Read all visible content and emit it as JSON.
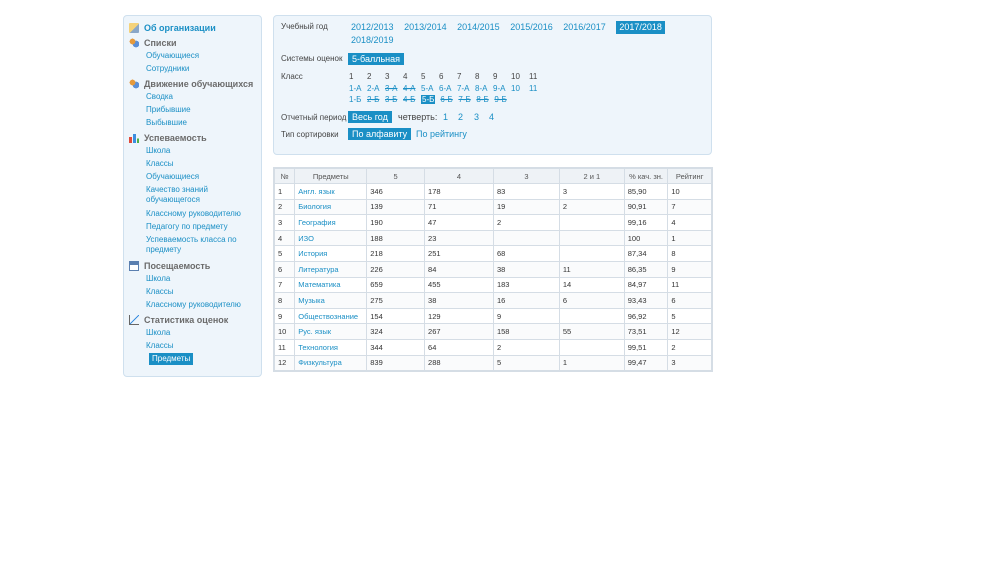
{
  "sidebar": {
    "org": "Об организации",
    "sections": [
      {
        "title": "Списки",
        "icon": "users-icon",
        "items": [
          "Обучающиеся",
          "Сотрудники"
        ]
      },
      {
        "title": "Движение обучающихся",
        "icon": "users-icon",
        "items": [
          "Сводка",
          "Прибывшие",
          "Выбывшие"
        ]
      },
      {
        "title": "Успеваемость",
        "icon": "bar-chart-icon",
        "items": [
          "Школа",
          "Классы",
          "Обучающиеся",
          "Качество знаний обучающегося",
          "Классному руководителю",
          "Педагогу по предмету",
          "Успеваемость класса по предмету"
        ]
      },
      {
        "title": "Посещаемость",
        "icon": "calendar-icon",
        "items": [
          "Школа",
          "Классы",
          "Классному руководителю"
        ]
      },
      {
        "title": "Статистика оценок",
        "icon": "line-chart-icon",
        "items": [
          "Школа",
          "Классы",
          "Предметы"
        ],
        "active": "Предметы"
      }
    ]
  },
  "filters": {
    "year_label": "Учебный год",
    "years": [
      "2012/2013",
      "2013/2014",
      "2014/2015",
      "2015/2016",
      "2016/2017",
      "2017/2018",
      "2018/2019"
    ],
    "year_selected": "2017/2018",
    "grading_label": "Системы оценок",
    "grading_value": "5-балльная",
    "class_label": "Класс",
    "class_numbers": [
      "1",
      "2",
      "3",
      "4",
      "5",
      "6",
      "7",
      "8",
      "9",
      "10",
      "11"
    ],
    "class_row_a": [
      "1-А",
      "2-А",
      "3-А",
      "4-А",
      "5-А",
      "6-А",
      "7-А",
      "8-А",
      "9-А",
      "10",
      "11"
    ],
    "class_row_b": [
      "1-Б",
      "2-Б",
      "3-Б",
      "4-Б",
      "5-Б",
      "6-Б",
      "7-Б",
      "8-Б",
      "9-Б"
    ],
    "class_selected": "5-Б",
    "period_label": "Отчетный период",
    "period_value": "Весь год",
    "quarter_label": "четверть:",
    "quarters": [
      "1",
      "2",
      "3",
      "4"
    ],
    "sort_label": "Тип сортировки",
    "sort_value": "По алфавиту",
    "sort_alt": "По рейтингу"
  },
  "table": {
    "headers": [
      "№",
      "Предметы",
      "5",
      "4",
      "3",
      "2 и 1",
      "% кач. зн.",
      "Рейтинг"
    ],
    "rows": [
      [
        "1",
        "Англ. язык",
        "346",
        "178",
        "83",
        "3",
        "85,90",
        "10"
      ],
      [
        "2",
        "Биология",
        "139",
        "71",
        "19",
        "2",
        "90,91",
        "7"
      ],
      [
        "3",
        "География",
        "190",
        "47",
        "2",
        "",
        "99,16",
        "4"
      ],
      [
        "4",
        "ИЗО",
        "188",
        "23",
        "",
        "",
        "100",
        "1"
      ],
      [
        "5",
        "История",
        "218",
        "251",
        "68",
        "",
        "87,34",
        "8"
      ],
      [
        "6",
        "Литература",
        "226",
        "84",
        "38",
        "11",
        "86,35",
        "9"
      ],
      [
        "7",
        "Математика",
        "659",
        "455",
        "183",
        "14",
        "84,97",
        "11"
      ],
      [
        "8",
        "Музыка",
        "275",
        "38",
        "16",
        "6",
        "93,43",
        "6"
      ],
      [
        "9",
        "Обществознание",
        "154",
        "129",
        "9",
        "",
        "96,92",
        "5"
      ],
      [
        "10",
        "Рус. язык",
        "324",
        "267",
        "158",
        "55",
        "73,51",
        "12"
      ],
      [
        "11",
        "Технология",
        "344",
        "64",
        "2",
        "",
        "99,51",
        "2"
      ],
      [
        "12",
        "Физкультура",
        "839",
        "288",
        "5",
        "1",
        "99,47",
        "3"
      ]
    ]
  }
}
